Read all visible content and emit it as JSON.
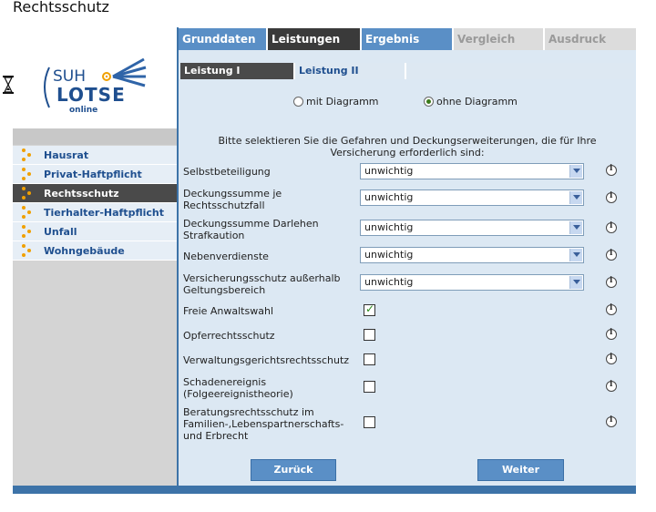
{
  "page": {
    "title": "Rechtsschutz"
  },
  "logo": {
    "brand_top": "SUH",
    "brand_main": "LOTSE",
    "brand_sub": "online"
  },
  "colors": {
    "accent_blue": "#3d73a8",
    "tab_active": "#3a3a3a",
    "nav_active": "#4a4a4a",
    "content_bg": "#dce8f3",
    "dots": "#f0a000"
  },
  "nav": {
    "items": [
      {
        "label": "Hausrat",
        "active": false
      },
      {
        "label": "Privat-Haftpflicht",
        "active": false
      },
      {
        "label": "Rechtsschutz",
        "active": true
      },
      {
        "label": "Tierhalter-Haftpflicht",
        "active": false
      },
      {
        "label": "Unfall",
        "active": false
      },
      {
        "label": "Wohngebäude",
        "active": false
      }
    ]
  },
  "tabs": [
    {
      "label": "Grunddaten",
      "state": "normal"
    },
    {
      "label": "Leistungen",
      "state": "active"
    },
    {
      "label": "Ergebnis",
      "state": "normal"
    },
    {
      "label": "Vergleich",
      "state": "disabled"
    },
    {
      "label": "Ausdruck",
      "state": "disabled"
    }
  ],
  "subtabs": [
    {
      "label": "Leistung I",
      "active": true
    },
    {
      "label": "Leistung II",
      "active": false
    }
  ],
  "diagram": {
    "option_with": "mit Diagramm",
    "option_without": "ohne Diagramm",
    "selected": "ohne Diagramm"
  },
  "form": {
    "intro": "Bitte selektieren Sie die Gefahren und Deckungserweiterungen, die für Ihre Versicherung erforderlich sind:",
    "selects": [
      {
        "label": "Selbstbeteiligung",
        "value": "unwichtig"
      },
      {
        "label": "Deckungssumme je Rechtsschutzfall",
        "value": "unwichtig"
      },
      {
        "label": "Deckungssumme Darlehen Strafkaution",
        "value": "unwichtig"
      },
      {
        "label": "Nebenverdienste",
        "value": "unwichtig"
      },
      {
        "label": "Versicherungsschutz außerhalb Geltungsbereich",
        "value": "unwichtig"
      }
    ],
    "checks": [
      {
        "label": "Freie Anwaltswahl",
        "checked": true
      },
      {
        "label": "Opferrechtsschutz",
        "checked": false
      },
      {
        "label": "Verwaltungsgerichtsrechtsschutz",
        "checked": false
      },
      {
        "label": "Schadenereignis (Folgeereignistheorie)",
        "checked": false
      },
      {
        "label": "Beratungsrechtsschutz im Familien-,Lebenspartnerschafts- und Erbrecht",
        "checked": false
      }
    ]
  },
  "buttons": {
    "back": "Zurück",
    "next": "Weiter"
  },
  "icons": {
    "info": "info-icon",
    "hourglass": "hourglass-icon",
    "dropdown": "chevron-down-icon",
    "bullet": "dots-bullet-icon"
  }
}
